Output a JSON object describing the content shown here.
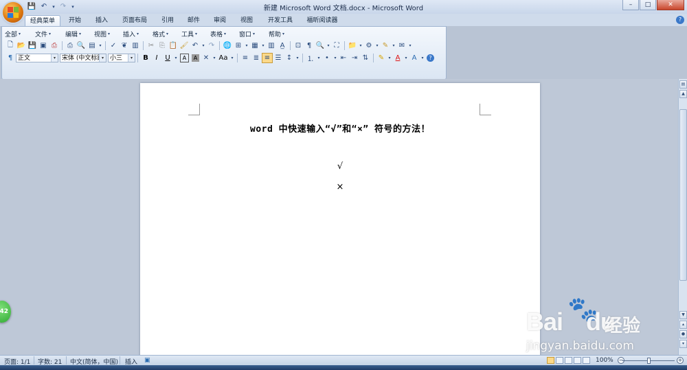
{
  "window": {
    "title": "新建 Microsoft Word 文档.docx - Microsoft Word",
    "minimize": "–",
    "maximize": "□",
    "close": "✕"
  },
  "qat": {
    "save": "💾",
    "undo": "↶",
    "redo": "↷",
    "more": "▾"
  },
  "tabs": [
    {
      "label": "经典菜单",
      "active": true
    },
    {
      "label": "开始"
    },
    {
      "label": "插入"
    },
    {
      "label": "页面布局"
    },
    {
      "label": "引用"
    },
    {
      "label": "邮件"
    },
    {
      "label": "审阅"
    },
    {
      "label": "视图"
    },
    {
      "label": "开发工具"
    },
    {
      "label": "福昕阅读器"
    }
  ],
  "help": "?",
  "menu": [
    {
      "label": "全部"
    },
    {
      "label": "文件"
    },
    {
      "label": "编辑"
    },
    {
      "label": "视图"
    },
    {
      "label": "插入"
    },
    {
      "label": "格式"
    },
    {
      "label": "工具"
    },
    {
      "label": "表格"
    },
    {
      "label": "窗口"
    },
    {
      "label": "帮助"
    }
  ],
  "format_bar": {
    "style": "正文",
    "font": "宋体 (中文标题",
    "size": "小三",
    "bold": "B",
    "italic": "I",
    "underline": "U",
    "char_border": "A",
    "char_shading": "A",
    "change_case": "Aa",
    "font_color": "A",
    "highlight": "A"
  },
  "document": {
    "title": "word 中快速输入“√”和“×” 符号的方法！",
    "line1": "√",
    "line2": "×"
  },
  "statusbar": {
    "page": "页面: 1/1",
    "words": "字数: 21",
    "language": "中文(简体，中国)",
    "mode": "插入",
    "zoom": "100%",
    "zoom_level": 0.5
  },
  "badge": "42",
  "watermark": {
    "brand": "Bai",
    "brand_tail": "du",
    "cn": "经验",
    "url": "jingyan.baidu.com"
  }
}
